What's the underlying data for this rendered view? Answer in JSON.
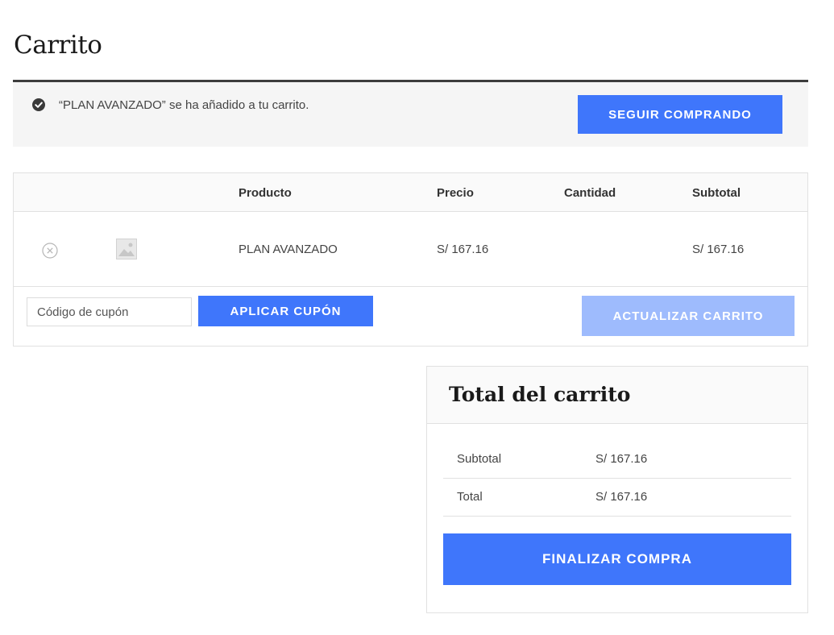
{
  "page": {
    "title": "Carrito"
  },
  "notice": {
    "message": "“PLAN AVANZADO” se ha añadido a tu carrito.",
    "icon": "check-circle-icon",
    "continue_label": "Seguir comprando"
  },
  "cart": {
    "columns": [
      "",
      "",
      "Producto",
      "Precio",
      "Cantidad",
      "Subtotal"
    ],
    "items": [
      {
        "product": "PLAN AVANZADO",
        "price": "S/ 167.16",
        "quantity": "",
        "subtotal": "S/ 167.16"
      }
    ],
    "coupon_placeholder": "Código de cupón",
    "apply_coupon_label": "Aplicar cupón",
    "update_cart_label": "Actualizar carrito"
  },
  "totals": {
    "title": "Total del carrito",
    "rows": [
      {
        "label": "Subtotal",
        "value": "S/ 167.16"
      },
      {
        "label": "Total",
        "value": "S/ 167.16"
      }
    ],
    "checkout_label": "Finalizar compra"
  },
  "colors": {
    "accent": "#3f76fb",
    "accent_disabled": "#9ebbfd",
    "notice_bg": "#f5f5f5",
    "notice_border": "#3d3d3d"
  }
}
